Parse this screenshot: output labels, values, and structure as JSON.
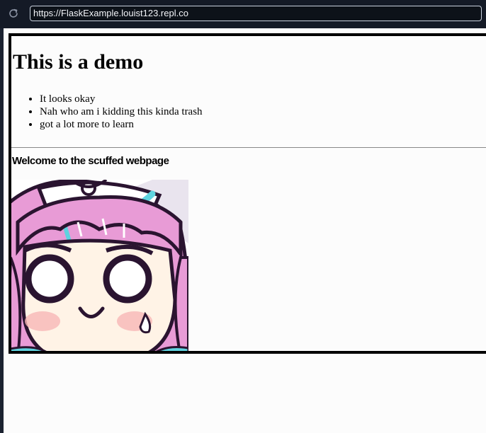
{
  "browser": {
    "url": "https://FlaskExample.louist123.repl.co",
    "reload_icon": "reload-icon"
  },
  "page": {
    "title": "This is a demo",
    "list_items": [
      "It looks okay",
      "Nah who am i kidding this kinda trash",
      "got a lot more to learn"
    ],
    "welcome_heading": "Welcome to the scuffed webpage",
    "image": "chibi-anime-character-portrait"
  },
  "colors": {
    "chrome_bg": "#141a26",
    "url_bar_bg": "#0d1219",
    "page_bg": "#fcfcfc",
    "frame_border": "#000000"
  }
}
